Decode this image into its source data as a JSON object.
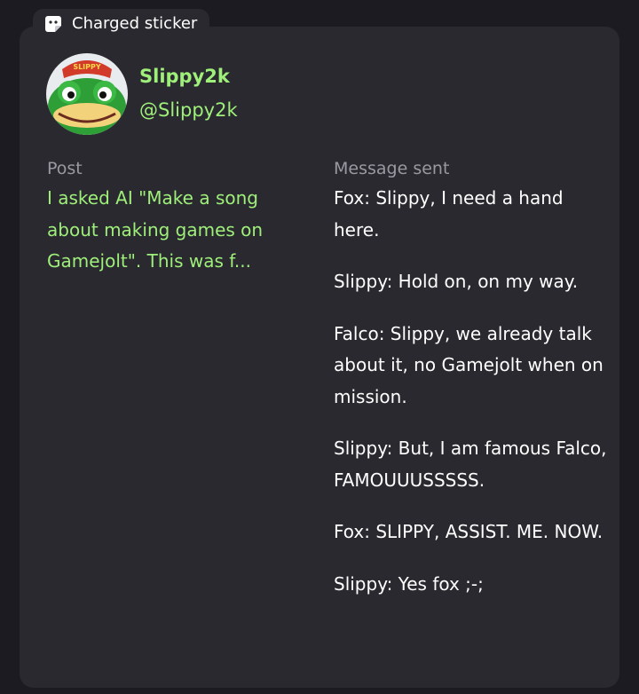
{
  "badge": {
    "label": "Charged sticker",
    "icon": "sticker-icon"
  },
  "user": {
    "display_name": "Slippy2k",
    "username": "@Slippy2k",
    "avatar_cap_text": "SLIPPY"
  },
  "post": {
    "label": "Post",
    "text": "I asked AI \"Make a song about making games on Gamejolt\". This was f..."
  },
  "message": {
    "label": "Message sent",
    "lines": [
      "Fox: Slippy, I need a hand here.",
      "Slippy: Hold on, on my way.",
      "Falco: Slippy, we already talk about it, no Gamejolt when on mission.",
      "Slippy: But, I am famous Falco, FAMOUUUSSSSS.",
      "Fox: SLIPPY, ASSIST. ME. NOW.",
      "Slippy: Yes fox ;-;"
    ]
  },
  "colors": {
    "accent_green": "#9ef07a",
    "card_bg": "#2a292f",
    "page_bg": "#1c1b21"
  }
}
